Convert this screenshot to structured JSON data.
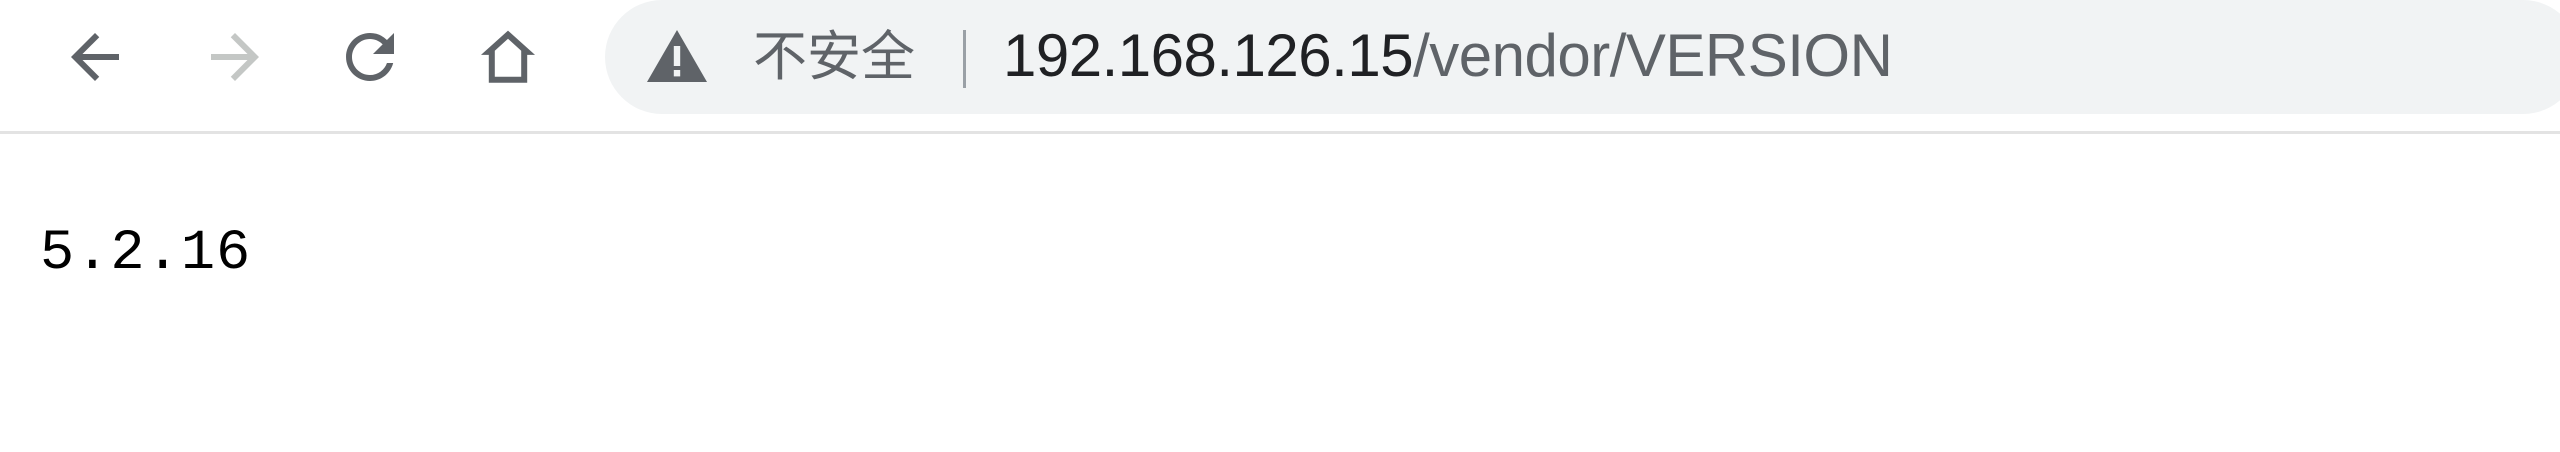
{
  "toolbar": {
    "buttons": {
      "back": "back-arrow-icon",
      "forward": "forward-arrow-icon",
      "reload": "reload-icon",
      "home": "home-icon"
    },
    "omnibox": {
      "security_icon": "warning-triangle-icon",
      "security_label": "不安全",
      "url_host": "192.168.126.15",
      "url_path": "/vendor/VERSION"
    }
  },
  "page": {
    "body_text": "5.2.16"
  },
  "colors": {
    "active_icon": "#5f6368",
    "disabled_icon": "#c4c7c5",
    "omnibox_bg": "#f1f3f4",
    "url_host": "#202124"
  }
}
